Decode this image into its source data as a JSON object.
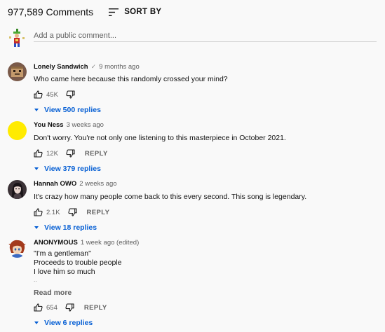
{
  "header": {
    "comment_count": "977,589 Comments",
    "sort_label": "SORT BY"
  },
  "add_comment": {
    "placeholder": "Add a public comment..."
  },
  "comments": [
    {
      "author": "Lonely Sandwich",
      "verified_icon": "check-icon",
      "time": "9 months ago",
      "text": "Who came here because this randomly crossed your mind?",
      "likes": "45K",
      "replies": "View 500 replies"
    },
    {
      "author": "You Ness",
      "time": "3 weeks ago",
      "text": "Don't worry. You're not only one listening to this masterpiece in October 2021.",
      "likes": "12K",
      "reply_label": "REPLY",
      "replies": "View 379 replies"
    },
    {
      "author": "Hannah OWO",
      "time": "2 weeks ago",
      "text": "It's crazy how many people come back to this every second. This song is legendary.",
      "likes": "2.1K",
      "reply_label": "REPLY",
      "replies": "View 18 replies"
    },
    {
      "author": "ANONYMOUS",
      "time": "1 week ago (edited)",
      "lines": [
        "\"I'm a gentleman\"",
        "Proceeds to trouble people",
        "I love him so much",
        ".."
      ],
      "read_more": "Read more",
      "likes": "654",
      "reply_label": "REPLY",
      "replies": "View 6 replies"
    }
  ],
  "colors": {
    "background": "#f9f9f9",
    "link_blue": "#065fd4",
    "secondary_text": "#606060",
    "avatar_yellow": "#ffeb00"
  }
}
